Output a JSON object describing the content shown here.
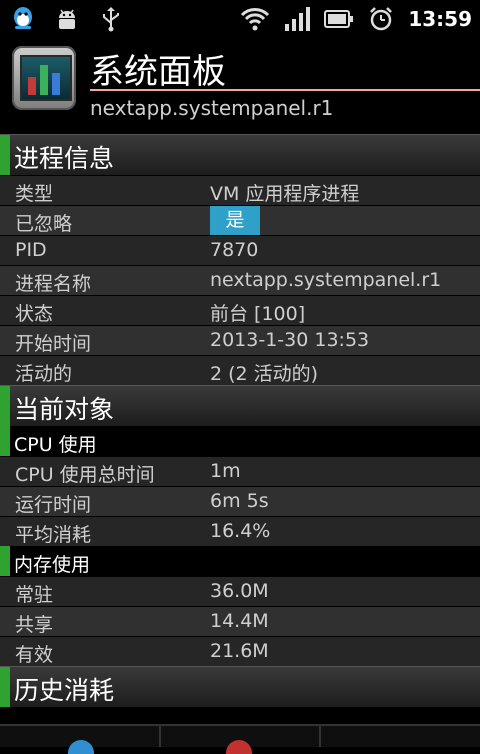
{
  "statusbar": {
    "time": "13:59",
    "left_icons": [
      "qq-icon",
      "android-icon",
      "usb-icon"
    ],
    "right_icons": [
      "wifi-icon",
      "signal-icon",
      "battery-icon",
      "alarm-icon"
    ]
  },
  "app": {
    "title": "系统面板",
    "subtitle": "nextapp.systempanel.r1"
  },
  "sections": {
    "process_info": "进程信息",
    "current_object": "当前对象",
    "cpu_usage": "CPU 使用",
    "memory_usage": "内存使用",
    "history": "历史消耗"
  },
  "process": {
    "type": {
      "k": "类型",
      "v": "VM 应用程序进程"
    },
    "ignored": {
      "k": "已忽略",
      "v": "是"
    },
    "pid": {
      "k": "PID",
      "v": "7870"
    },
    "name": {
      "k": "进程名称",
      "v": "nextapp.systempanel.r1"
    },
    "state": {
      "k": "状态",
      "v": "前台 [100]"
    },
    "start": {
      "k": "开始时间",
      "v": "2013-1-30 13:53"
    },
    "active": {
      "k": "活动的",
      "v": "2 (2 活动的)"
    }
  },
  "cpu": {
    "total": {
      "k": "CPU 使用总时间",
      "v": "1m"
    },
    "runtime": {
      "k": "运行时间",
      "v": "6m 5s"
    },
    "avg": {
      "k": "平均消耗",
      "v": "16.4%"
    }
  },
  "memory": {
    "resident": {
      "k": "常驻",
      "v": "36.0M"
    },
    "shared": {
      "k": "共享",
      "v": "14.4M"
    },
    "effective": {
      "k": "有效",
      "v": "21.6M"
    }
  },
  "colors": {
    "accent_green": "#2fa22f",
    "badge_blue": "#2fa0c8",
    "title_underline": "#f2a79a"
  }
}
